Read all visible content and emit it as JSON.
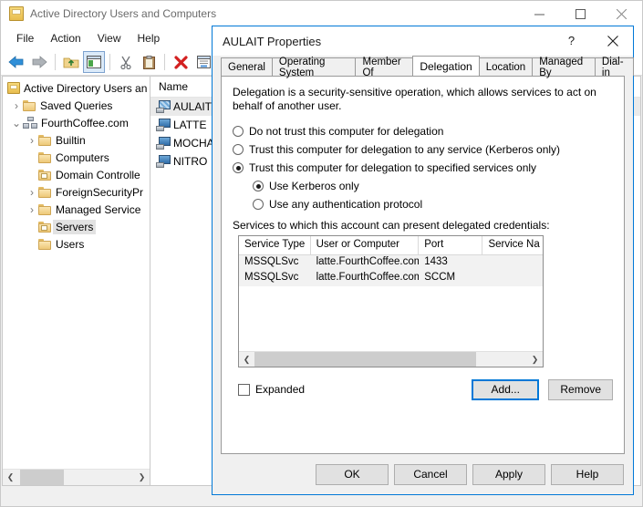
{
  "main_window": {
    "title": "Active Directory Users and Computers",
    "app_icon": "console-icon",
    "window_controls": {
      "minimize": "minimize-icon",
      "maximize": "maximize-icon",
      "close": "close-icon"
    },
    "menus": [
      "File",
      "Action",
      "View",
      "Help"
    ],
    "toolbar": [
      {
        "name": "back-icon"
      },
      {
        "name": "forward-icon"
      },
      {
        "name": "up-folder-icon"
      },
      {
        "name": "show-hide-console-tree-icon",
        "selected": true
      },
      {
        "name": "cut-icon"
      },
      {
        "name": "paste-icon"
      },
      {
        "name": "delete-icon"
      },
      {
        "name": "properties-icon"
      },
      {
        "name": "refresh-icon"
      }
    ],
    "tree": [
      {
        "label": "Active Directory Users an",
        "indent": 0,
        "chevron": "",
        "icon": "console-root-icon",
        "selected": false
      },
      {
        "label": "Saved Queries",
        "indent": 1,
        "chevron": "›",
        "icon": "folder-icon",
        "selected": false
      },
      {
        "label": "FourthCoffee.com",
        "indent": 1,
        "chevron": "⌄",
        "icon": "domain-icon",
        "selected": false
      },
      {
        "label": "Builtin",
        "indent": 2,
        "chevron": "›",
        "icon": "folder-icon",
        "selected": false
      },
      {
        "label": "Computers",
        "indent": 2,
        "chevron": "",
        "icon": "folder-icon",
        "selected": false
      },
      {
        "label": "Domain Controlle",
        "indent": 2,
        "chevron": "",
        "icon": "ou-folder-icon",
        "selected": false
      },
      {
        "label": "ForeignSecurityPr",
        "indent": 2,
        "chevron": "›",
        "icon": "folder-icon",
        "selected": false
      },
      {
        "label": "Managed Service",
        "indent": 2,
        "chevron": "›",
        "icon": "folder-icon",
        "selected": false
      },
      {
        "label": "Servers",
        "indent": 2,
        "chevron": "",
        "icon": "ou-folder-icon",
        "selected": true
      },
      {
        "label": "Users",
        "indent": 2,
        "chevron": "",
        "icon": "folder-icon",
        "selected": false
      }
    ],
    "list": {
      "column_header": "Name",
      "rows": [
        {
          "label": "AULAIT",
          "icon": "computer-icon",
          "selected": true
        },
        {
          "label": "LATTE",
          "icon": "computer-icon",
          "selected": false
        },
        {
          "label": "MOCHA",
          "icon": "computer-icon",
          "selected": false
        },
        {
          "label": "NITRO",
          "icon": "computer-icon",
          "selected": false
        }
      ]
    },
    "tree_scrollbar": {
      "left_arrow": "❮",
      "right_arrow": "❯"
    }
  },
  "dialog": {
    "title": "AULAIT Properties",
    "help_button": "?",
    "close_button": "✕",
    "tabs": [
      {
        "label": "General",
        "active": false
      },
      {
        "label": "Operating System",
        "active": false
      },
      {
        "label": "Member Of",
        "active": false
      },
      {
        "label": "Delegation",
        "active": true
      },
      {
        "label": "Location",
        "active": false
      },
      {
        "label": "Managed By",
        "active": false
      },
      {
        "label": "Dial-in",
        "active": false
      }
    ],
    "delegation": {
      "description": "Delegation is a security-sensitive operation, which allows services to act on behalf of another user.",
      "options": [
        {
          "label": "Do not trust this computer for delegation",
          "checked": false
        },
        {
          "label": "Trust this computer for delegation to any service (Kerberos only)",
          "checked": false
        },
        {
          "label": "Trust this computer for delegation to specified services only",
          "checked": true
        }
      ],
      "sub_options": [
        {
          "label": "Use Kerberos only",
          "checked": true
        },
        {
          "label": "Use any authentication protocol",
          "checked": false
        }
      ],
      "services_label": "Services to which this account can present delegated credentials:",
      "table": {
        "columns": [
          "Service Type",
          "User or Computer",
          "Port",
          "Service Na"
        ],
        "rows": [
          [
            "MSSQLSvc",
            "latte.FourthCoffee.com",
            "1433",
            ""
          ],
          [
            "MSSQLSvc",
            "latte.FourthCoffee.com",
            "SCCM",
            ""
          ]
        ]
      },
      "scrollbar": {
        "left_arrow": "❮",
        "right_arrow": "❯"
      },
      "expanded_checkbox": {
        "label": "Expanded",
        "checked": false
      },
      "add_button": "Add...",
      "remove_button": "Remove"
    },
    "footer_buttons": [
      "OK",
      "Cancel",
      "Apply",
      "Help"
    ],
    "accent_color": "#0078d7"
  }
}
